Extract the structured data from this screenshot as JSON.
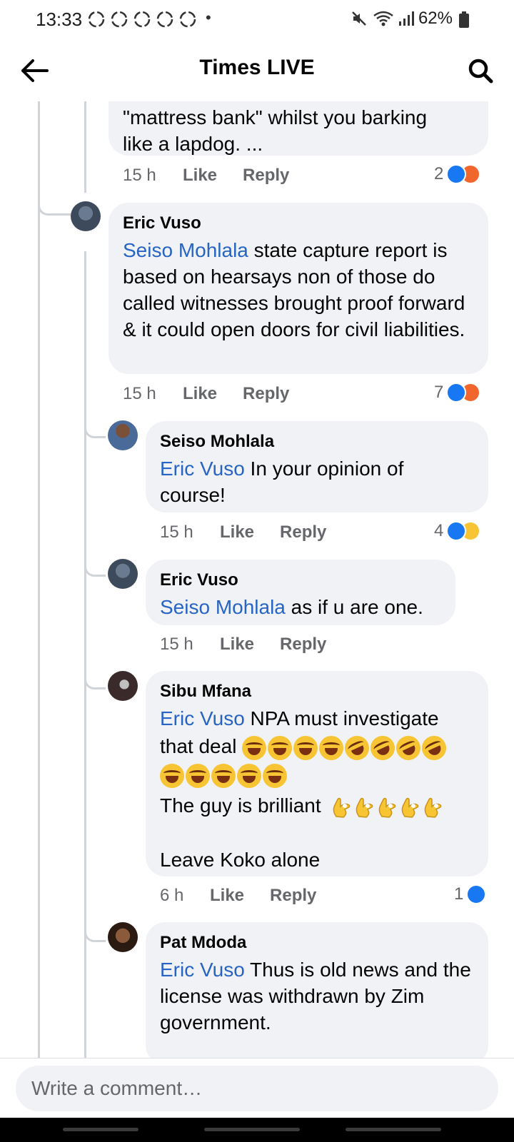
{
  "status_bar": {
    "time": "13:33",
    "dot": "•",
    "battery": "62%",
    "icons": [
      "recycle-notification-icon",
      "mute-icon",
      "wifi-icon",
      "signal-icon",
      "battery-icon"
    ]
  },
  "header": {
    "title": "Times LIVE",
    "back_icon": "back-arrow-icon",
    "search_icon": "search-icon"
  },
  "comments": [
    {
      "author": "",
      "text_lines": [
        "\"mattress bank\" whilst you barking",
        "like a lapdog. ..."
      ],
      "time": "15 h",
      "like": "Like",
      "reply": "Reply",
      "reaction_count": "2",
      "reactions": [
        "like",
        "angry"
      ]
    },
    {
      "author": "Eric Vuso",
      "mention": "Seiso Mohlala",
      "text_after_mention": " state capture report is based on hearsays non of those do called witnesses brought proof forward & it could open doors for civil liabilities.",
      "time": "15 h",
      "like": "Like",
      "reply": "Reply",
      "reaction_count": "7",
      "reactions": [
        "like",
        "angry"
      ]
    },
    {
      "author": "Seiso Mohlala",
      "mention": "Eric Vuso",
      "text_after_mention": " In your opinion of course!",
      "time": "15 h",
      "like": "Like",
      "reply": "Reply",
      "reaction_count": "4",
      "reactions": [
        "like",
        "haha"
      ]
    },
    {
      "author": "Eric Vuso",
      "mention": "Seiso Mohlala",
      "text_after_mention": " as if u are one.",
      "time": "15 h",
      "like": "Like",
      "reply": "Reply"
    },
    {
      "author": "Sibu Mfana",
      "mention": "Eric Vuso",
      "text_after_mention": " NPA must investigate",
      "line2": "that deal",
      "line4": "The guy is brilliant",
      "line5": "Leave Koko alone",
      "time": "6 h",
      "like": "Like",
      "reply": "Reply",
      "reaction_count": "1",
      "reactions": [
        "like"
      ]
    },
    {
      "author": "Pat Mdoda",
      "mention": "Eric Vuso",
      "text_after_mention": " Thus is old news and the license was withdrawn by Zim government.",
      "time": "",
      "like": "",
      "reply": ""
    }
  ],
  "composer": {
    "placeholder": "Write a comment…"
  },
  "colors": {
    "mention": "#2864c4",
    "bubble": "#f0f2f5",
    "like_blue": "#1877f2",
    "angry_orange": "#f0662c",
    "haha_yellow": "#f7c533"
  }
}
